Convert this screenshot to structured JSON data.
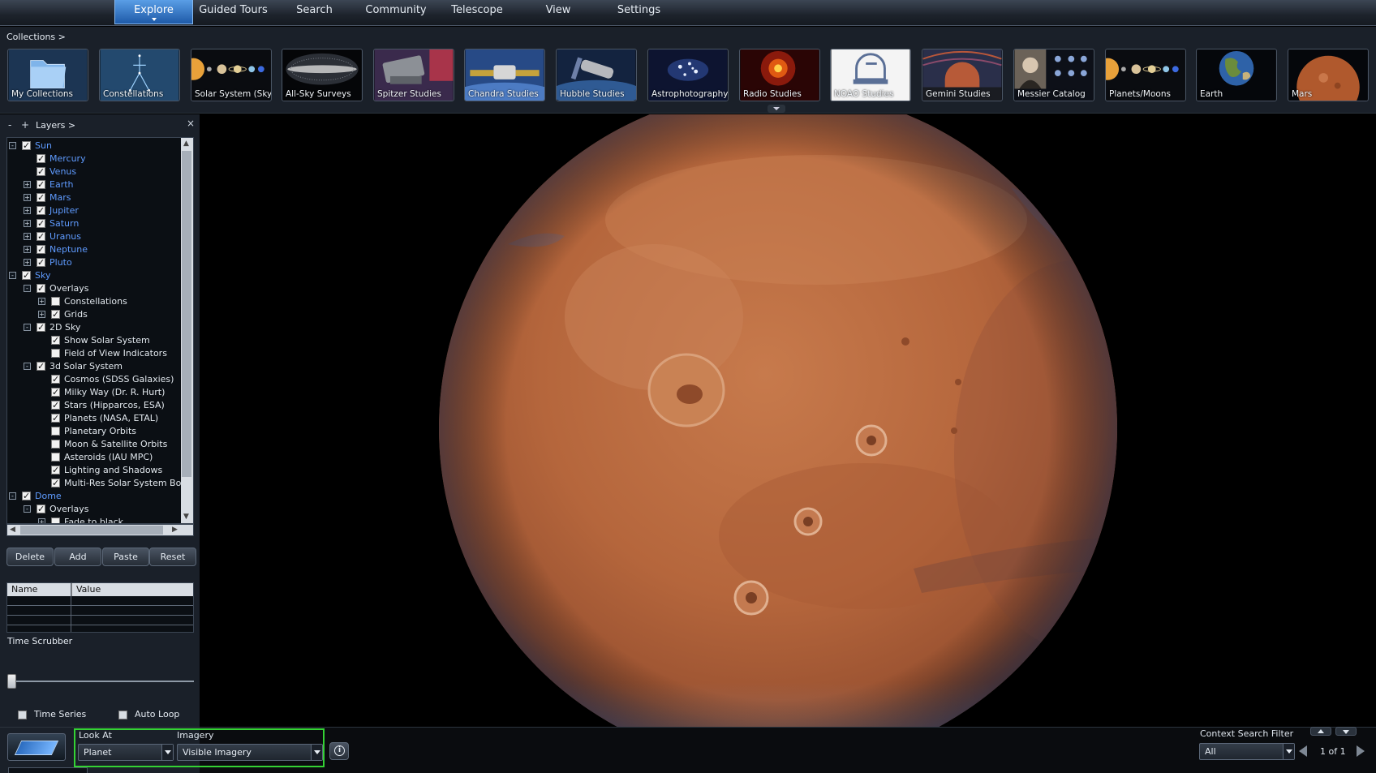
{
  "menu": {
    "items": [
      {
        "label": "Explore",
        "active": true
      },
      {
        "label": "Guided Tours"
      },
      {
        "label": "Search"
      },
      {
        "label": "Community"
      },
      {
        "label": "Telescope"
      },
      {
        "label": "View"
      },
      {
        "label": "Settings"
      }
    ]
  },
  "collections": {
    "breadcrumb": "Collections  >",
    "items": [
      {
        "label": "My Collections",
        "icon": "folder-icon"
      },
      {
        "label": "Constellations",
        "icon": "constellation-icon"
      },
      {
        "label": "Solar System (Sky)",
        "icon": "planets-row-icon"
      },
      {
        "label": "All-Sky Surveys",
        "icon": "milky-way-icon"
      },
      {
        "label": "Spitzer Studies",
        "icon": "telescope-icon"
      },
      {
        "label": "Chandra Studies",
        "icon": "satellite-icon"
      },
      {
        "label": "Hubble Studies",
        "icon": "hubble-icon"
      },
      {
        "label": "Astrophotography",
        "icon": "star-cluster-icon"
      },
      {
        "label": "Radio Studies",
        "icon": "radio-nebula-icon"
      },
      {
        "label": "NOAO Studies",
        "icon": "observatory-icon"
      },
      {
        "label": "Gemini Studies",
        "icon": "dome-icon"
      },
      {
        "label": "Messier Catalog",
        "icon": "portrait-icon"
      },
      {
        "label": "Planets/Moons",
        "icon": "planets-row-icon"
      },
      {
        "label": "Earth",
        "icon": "earth-icon"
      },
      {
        "label": "Mars",
        "icon": "mars-icon"
      }
    ]
  },
  "layers": {
    "title": "Layers  >",
    "collapse_label": "-",
    "expand_label": "+",
    "close_label": "×",
    "rows": [
      {
        "label": "Sun",
        "level": 0,
        "expander": "-",
        "checked": true,
        "color": "blue"
      },
      {
        "label": "Mercury",
        "level": 1,
        "expander": "",
        "checked": true,
        "color": "blue"
      },
      {
        "label": "Venus",
        "level": 1,
        "expander": "",
        "checked": true,
        "color": "blue"
      },
      {
        "label": "Earth",
        "level": 1,
        "expander": "+",
        "checked": true,
        "color": "blue"
      },
      {
        "label": "Mars",
        "level": 1,
        "expander": "+",
        "checked": true,
        "color": "blue"
      },
      {
        "label": "Jupiter",
        "level": 1,
        "expander": "+",
        "checked": true,
        "color": "blue"
      },
      {
        "label": "Saturn",
        "level": 1,
        "expander": "+",
        "checked": true,
        "color": "blue"
      },
      {
        "label": "Uranus",
        "level": 1,
        "expander": "+",
        "checked": true,
        "color": "blue"
      },
      {
        "label": "Neptune",
        "level": 1,
        "expander": "+",
        "checked": true,
        "color": "blue"
      },
      {
        "label": "Pluto",
        "level": 1,
        "expander": "+",
        "checked": true,
        "color": "blue"
      },
      {
        "label": "Sky",
        "level": 0,
        "expander": "-",
        "checked": true,
        "color": "blue"
      },
      {
        "label": "Overlays",
        "level": 1,
        "expander": "-",
        "checked": true,
        "color": "white"
      },
      {
        "label": "Constellations",
        "level": 2,
        "expander": "+",
        "checked": false,
        "color": "white"
      },
      {
        "label": "Grids",
        "level": 2,
        "expander": "+",
        "checked": true,
        "color": "white"
      },
      {
        "label": "2D Sky",
        "level": 1,
        "expander": "-",
        "checked": true,
        "color": "white"
      },
      {
        "label": "Show Solar System",
        "level": 2,
        "expander": "",
        "checked": true,
        "color": "white"
      },
      {
        "label": "Field of View Indicators",
        "level": 2,
        "expander": "",
        "checked": false,
        "color": "white"
      },
      {
        "label": "3d Solar System",
        "level": 1,
        "expander": "-",
        "checked": true,
        "color": "white"
      },
      {
        "label": "Cosmos (SDSS Galaxies)",
        "level": 2,
        "expander": "",
        "checked": true,
        "color": "white"
      },
      {
        "label": "Milky Way (Dr. R. Hurt)",
        "level": 2,
        "expander": "",
        "checked": true,
        "color": "white"
      },
      {
        "label": "Stars (Hipparcos, ESA)",
        "level": 2,
        "expander": "",
        "checked": true,
        "color": "white"
      },
      {
        "label": "Planets (NASA, ETAL)",
        "level": 2,
        "expander": "",
        "checked": true,
        "color": "white"
      },
      {
        "label": "Planetary Orbits",
        "level": 2,
        "expander": "",
        "checked": false,
        "color": "white"
      },
      {
        "label": "Moon & Satellite Orbits",
        "level": 2,
        "expander": "",
        "checked": false,
        "color": "white"
      },
      {
        "label": "Asteroids (IAU MPC)",
        "level": 2,
        "expander": "",
        "checked": false,
        "color": "white"
      },
      {
        "label": "Lighting and Shadows",
        "level": 2,
        "expander": "",
        "checked": true,
        "color": "white"
      },
      {
        "label": "Multi-Res Solar System Bodies",
        "level": 2,
        "expander": "",
        "checked": true,
        "color": "white"
      },
      {
        "label": "Dome",
        "level": 0,
        "expander": "-",
        "checked": true,
        "color": "blue"
      },
      {
        "label": "Overlays",
        "level": 1,
        "expander": "-",
        "checked": true,
        "color": "white"
      },
      {
        "label": "Fade to black",
        "level": 2,
        "expander": "+",
        "checked": false,
        "color": "white"
      }
    ],
    "buttons": {
      "delete": "Delete",
      "add": "Add",
      "paste": "Paste",
      "reset": "Reset"
    }
  },
  "properties": {
    "col_name": "Name",
    "col_value": "Value"
  },
  "time": {
    "label": "Time Scrubber",
    "time_series": "Time Series",
    "auto_loop": "Auto Loop",
    "time_series_checked": false,
    "auto_loop_checked": false
  },
  "bottom": {
    "look_at_label": "Look At",
    "look_at_value": "Planet",
    "imagery_label": "Imagery",
    "imagery_value": "Visible Imagery",
    "info_label": "i",
    "context_filter_label": "Context Search Filter",
    "context_filter_value": "All",
    "page_count": "1 of 1"
  },
  "colors": {
    "accent": "#2f7bd8",
    "highlight_box": "#34d234",
    "layer_blue": "#5f9bff",
    "mars_surface": "#b5663c"
  }
}
